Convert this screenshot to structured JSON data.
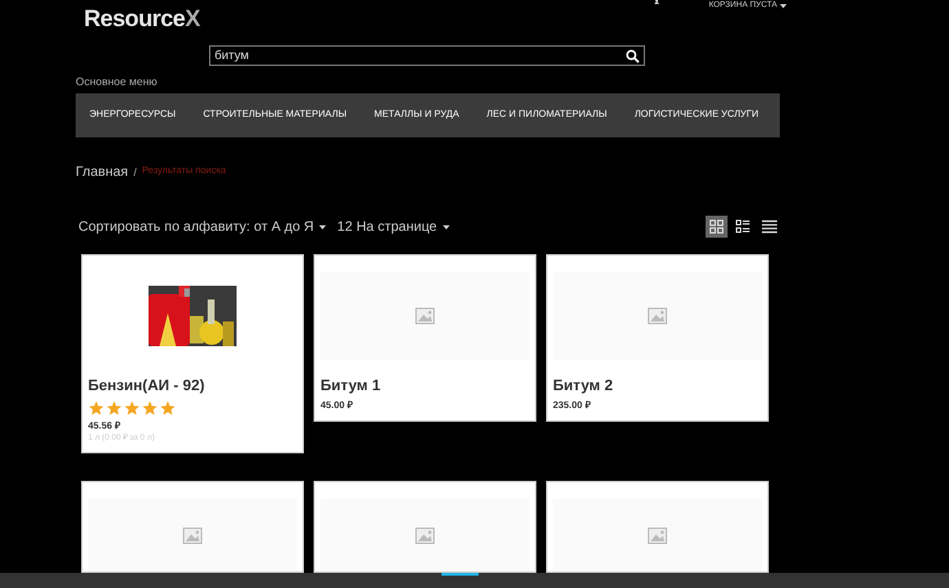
{
  "header": {
    "logo": {
      "main": "Resource",
      "accent": "X"
    },
    "cart": "КОРЗИНА ПУСТА"
  },
  "search": {
    "value": "битум"
  },
  "menu": {
    "title": "Основное меню",
    "items": [
      "ЭНЕРГОРЕСУРСЫ",
      "СТРОИТЕЛЬНЫЕ МАТЕРИАЛЫ",
      "МЕТАЛЛЫ И РУДА",
      "ЛЕС И ПИЛОМАТЕРИАЛЫ",
      "ЛОГИСТИЧЕСКИЕ УСЛУГИ"
    ]
  },
  "breadcrumb": [
    "Главная",
    "Результаты поиска"
  ],
  "breadcrumb_separator": "/",
  "toolbar": {
    "sort": "Сортировать по алфавиту: от А до Я",
    "per_page": "12 На странице",
    "views": [
      {
        "kind": "grid",
        "selected": true
      },
      {
        "kind": "list-grid",
        "selected": false
      },
      {
        "kind": "list",
        "selected": false
      }
    ]
  },
  "products": [
    {
      "kind": "picture",
      "name": "Бензин(АИ - 92)",
      "stars": 5,
      "price": "45.56 ₽",
      "unit": "1 л (0.00 ₽ за 0 л)"
    },
    {
      "kind": "placeholder",
      "name": "Битум 1",
      "price": "45.00 ₽"
    },
    {
      "kind": "placeholder",
      "name": "Битум 2",
      "price": "235.00 ₽"
    },
    {
      "kind": "placeholder"
    },
    {
      "kind": "placeholder"
    },
    {
      "kind": "placeholder"
    }
  ]
}
